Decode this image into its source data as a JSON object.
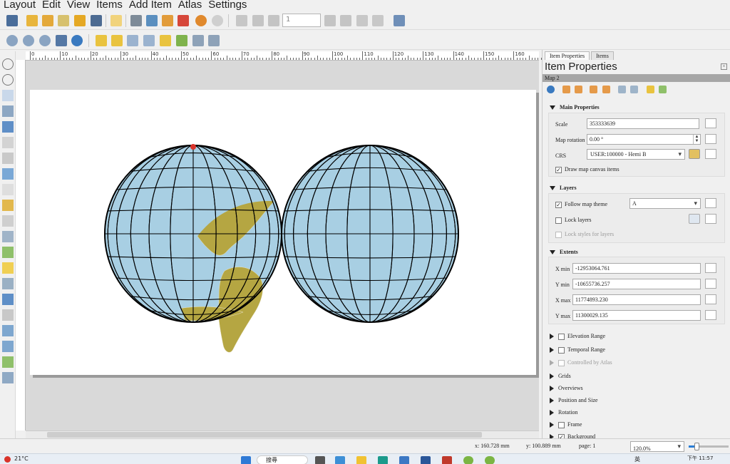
{
  "menu": [
    "Layout",
    "Edit",
    "View",
    "Items",
    "Add Item",
    "Atlas",
    "Settings"
  ],
  "toolbar": {
    "page_number": "1",
    "icons": [
      "save-icon",
      "new-layout-icon",
      "duplicate-layout-icon",
      "layout-manager-icon",
      "open-template-icon",
      "save-template-icon",
      "page-setup-icon",
      "print-icon",
      "export-image-icon",
      "export-svg-icon",
      "export-pdf-icon",
      "undo-icon",
      "redo-icon",
      "atlas-preview-icon",
      "first-feature-icon",
      "previous-feature-icon",
      "next-feature-icon",
      "last-feature-icon",
      "atlas-print-icon",
      "atlas-export-icon",
      "atlas-settings-icon"
    ],
    "view_icons": [
      "zoom-in-icon",
      "zoom-out-icon",
      "zoom-100-icon",
      "zoom-full-icon",
      "refresh-icon",
      "raise-icon",
      "lower-icon",
      "bring-front-icon",
      "send-back-icon",
      "align-left-icon",
      "align-top-icon",
      "distribute-icon",
      "resize-icon"
    ]
  },
  "left_tools": [
    "pan-icon",
    "zoom-tool-icon",
    "select-icon",
    "move-content-icon",
    "edit-nodes-icon",
    "add-map-icon",
    "add-3d-map-icon",
    "add-picture-icon",
    "add-label-icon",
    "add-legend-icon",
    "add-scalebar-icon",
    "add-north-arrow-icon",
    "add-shape-icon",
    "add-marker-icon",
    "add-arrow-icon",
    "add-polygon-icon",
    "add-polyline-icon",
    "add-html-icon",
    "add-attribute-table-icon",
    "add-fixed-table-icon",
    "add-elevation-profile-icon",
    "add-chart-icon"
  ],
  "ruler": {
    "labels": [
      "0",
      "10",
      "20",
      "30",
      "40",
      "50",
      "60",
      "70",
      "80",
      "90",
      "100",
      "110",
      "120",
      "130",
      "140",
      "150",
      "160"
    ]
  },
  "panel": {
    "tabs": [
      "Item Properties",
      "Items"
    ],
    "title": "Item Properties",
    "item_name": "Map 2",
    "main_properties": {
      "header": "Main Properties",
      "scale_label": "Scale",
      "scale_value": "353333639",
      "rotation_label": "Map rotation",
      "rotation_value": "0.00 °",
      "crs_label": "CRS",
      "crs_value": "USER:100000 - Hemi B",
      "draw_canvas_label": "Draw map canvas items"
    },
    "layers": {
      "header": "Layers",
      "follow_theme_label": "Follow map theme",
      "follow_theme_value": "A",
      "lock_layers_label": "Lock layers",
      "lock_styles_label": "Lock styles for layers"
    },
    "extents": {
      "header": "Extents",
      "xmin_label": "X min",
      "xmin_value": "-12953064.761",
      "ymin_label": "Y min",
      "ymin_value": "-10655736.257",
      "xmax_label": "X max",
      "xmax_value": "11774893.230",
      "ymax_label": "Y max",
      "ymax_value": "11300029.135"
    },
    "collapsed_sections": [
      "Elevation Range",
      "Temporal Range",
      "Controlled by Atlas",
      "Grids",
      "Overviews",
      "Position and Size",
      "Rotation",
      "Frame",
      "Background"
    ]
  },
  "status": {
    "x": "x: 160.728 mm",
    "y": "y: 100.889 mm",
    "page": "page: 1",
    "zoom": "120.0%",
    "zoom_fraction": 0.2
  },
  "taskbar": {
    "weather": "21°C",
    "search": "搜尋",
    "time": "下午 11:57",
    "ime": "英"
  },
  "colors": {
    "ocean": "#a8cfe3",
    "land": "#b5a642",
    "paper": "#ffffff",
    "canvas": "#d9d9d9"
  }
}
